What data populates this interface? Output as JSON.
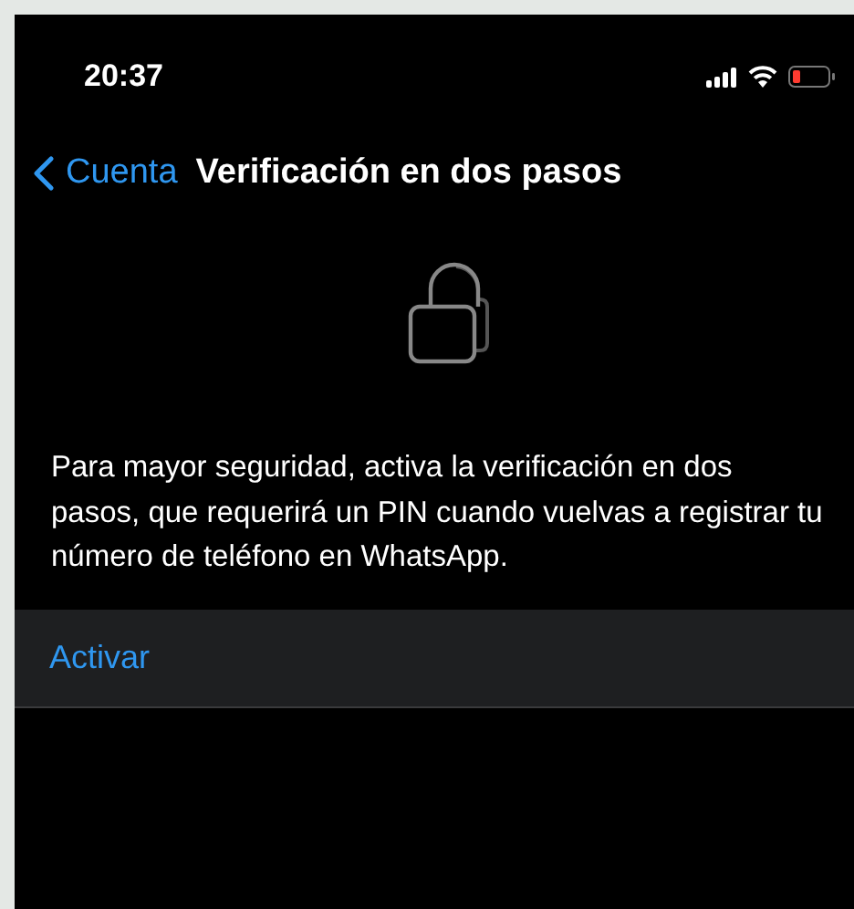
{
  "status_bar": {
    "time": "20:37"
  },
  "nav": {
    "back_label": "Cuenta",
    "title": "Verificación en dos pasos"
  },
  "description": "Para mayor seguridad, activa la verificación en dos pasos, que requerirá un PIN cuando vuelvas a registrar tu número de teléfono en WhatsApp.",
  "actions": [
    {
      "label": "Activar"
    }
  ]
}
